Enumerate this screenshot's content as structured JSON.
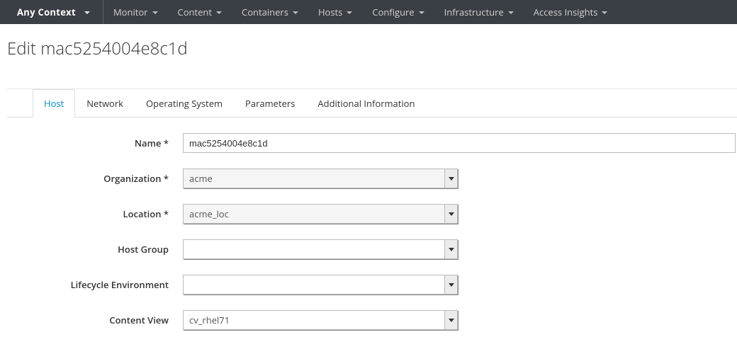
{
  "nav": {
    "context_label": "Any Context",
    "items": [
      {
        "label": "Monitor"
      },
      {
        "label": "Content"
      },
      {
        "label": "Containers"
      },
      {
        "label": "Hosts"
      },
      {
        "label": "Configure"
      },
      {
        "label": "Infrastructure"
      },
      {
        "label": "Access Insights"
      }
    ]
  },
  "page": {
    "title": "Edit mac5254004e8c1d"
  },
  "tabs": {
    "items": [
      {
        "label": "Host",
        "active": true
      },
      {
        "label": "Network"
      },
      {
        "label": "Operating System"
      },
      {
        "label": "Parameters"
      },
      {
        "label": "Additional Information"
      }
    ]
  },
  "form": {
    "name": {
      "label": "Name *",
      "value": "mac5254004e8c1d"
    },
    "organization": {
      "label": "Organization *",
      "value": "acme"
    },
    "location": {
      "label": "Location *",
      "value": "acme_loc"
    },
    "host_group": {
      "label": "Host Group",
      "value": ""
    },
    "lifecycle_environment": {
      "label": "Lifecycle Environment",
      "value": ""
    },
    "content_view": {
      "label": "Content View",
      "value": "cv_rhel71"
    }
  }
}
